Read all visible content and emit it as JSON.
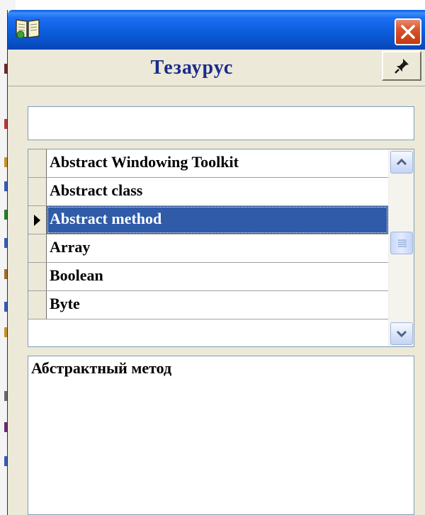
{
  "window": {
    "close_label": "×"
  },
  "header": {
    "title": "Тезаурус"
  },
  "search": {
    "value": "",
    "placeholder": ""
  },
  "terms": [
    {
      "label": "Abstract Windowing Toolkit",
      "selected": false
    },
    {
      "label": "Abstract class",
      "selected": false
    },
    {
      "label": "Abstract method",
      "selected": true
    },
    {
      "label": "Array",
      "selected": false
    },
    {
      "label": "Boolean",
      "selected": false
    },
    {
      "label": "Byte",
      "selected": false
    }
  ],
  "description": {
    "text": "Абстрактный метод"
  },
  "colors": {
    "title_bar": "#0a5ce8",
    "title_text": "#1a2b8c",
    "selection": "#2f5ba8",
    "close_button": "#d9532d"
  },
  "icons": {
    "app": "book-icon",
    "close": "close-icon",
    "pin": "pin-icon",
    "row_pointer": "row-pointer-icon",
    "scroll_up": "chevron-up-icon",
    "scroll_down": "chevron-down-icon",
    "scroll_grip": "scroll-grip-icon"
  }
}
